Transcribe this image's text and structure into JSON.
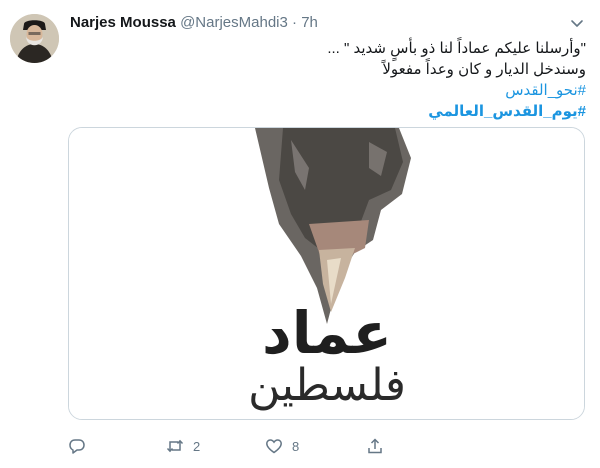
{
  "tweet": {
    "author_name": "Narjes Moussa",
    "handle": "@NarjesMahdi3",
    "separator": "·",
    "time": "7h",
    "text_lines": [
      "\"وأرسلنا عليكم عماداً لنا ذو بأسٍ شديد \" ...",
      "وسندخل الديار و كان وعداً مفعولاً"
    ],
    "hashtags": [
      "#نحو_القدس",
      "#يوم_القدس_العالمي"
    ],
    "media": {
      "title_word": "عماد",
      "subtitle_word": "فلسطين"
    },
    "actions": {
      "reply_count": "",
      "retweet_count": "2",
      "like_count": "8"
    }
  },
  "icons": [
    "chevron-down-icon",
    "reply-icon",
    "retweet-icon",
    "like-icon",
    "share-icon"
  ],
  "colors": {
    "link": "#1b95e0",
    "muted": "#657786",
    "border": "#ccd6dd"
  }
}
